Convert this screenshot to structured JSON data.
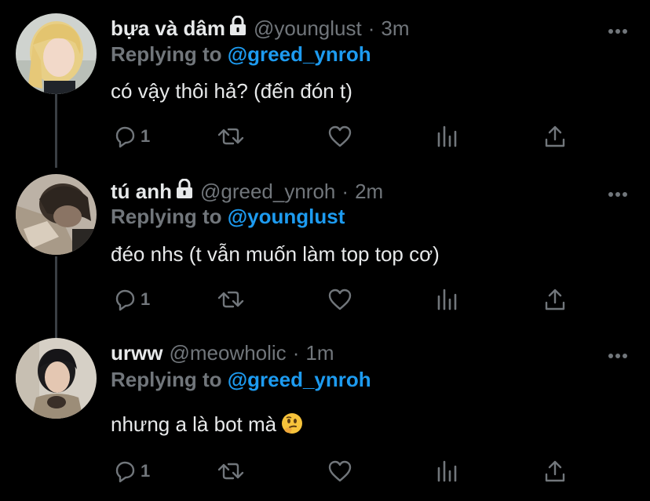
{
  "colors": {
    "background": "#000000",
    "text_primary": "#e7e9ea",
    "text_secondary": "#71767b",
    "accent": "#1d9bf0",
    "thread_line": "#3a3f44"
  },
  "tweets": [
    {
      "display_name": "bựa và dâm",
      "protected": true,
      "handle": "@younglust",
      "separator": "·",
      "time": "3m",
      "replying_label": "Replying to",
      "replying_to": "@greed_ynroh",
      "text": "có vậy thôi hả? (đến đón t)",
      "reply_count": "1",
      "avatar_icon": "avatar-blonde-person"
    },
    {
      "display_name": "tú anh",
      "protected": true,
      "handle": "@greed_ynroh",
      "separator": "·",
      "time": "2m",
      "replying_label": "Replying to",
      "replying_to": "@younglust",
      "text": "đéo nhs (t vẫn muốn làm top top cơ)",
      "reply_count": "1",
      "avatar_icon": "avatar-dark-hair-person"
    },
    {
      "display_name": "urww",
      "protected": false,
      "handle": "@meowholic",
      "separator": "·",
      "time": "1m",
      "replying_label": "Replying to",
      "replying_to": "@greed_ynroh",
      "text": "nhưng a là bot mà",
      "text_emoji": "thinking-face-emoji",
      "reply_count": "1",
      "avatar_icon": "avatar-black-hair-person"
    }
  ],
  "action_icons": [
    "reply-icon",
    "retweet-icon",
    "like-icon",
    "analytics-icon",
    "share-icon"
  ],
  "more_icon": "more-options-icon"
}
